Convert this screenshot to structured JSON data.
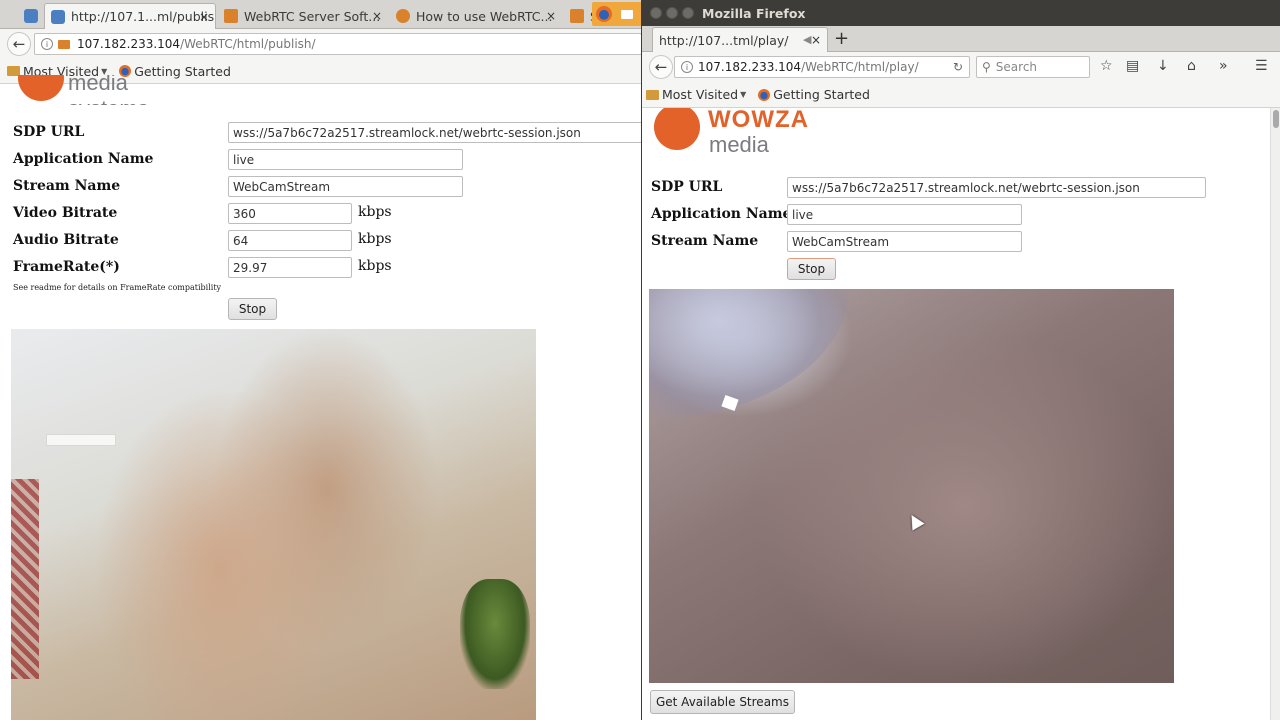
{
  "left_window": {
    "tabs": [
      {
        "label": "http://107.1...ml/publish/",
        "active": true
      },
      {
        "label": "WebRTC Server Soft...",
        "active": false
      },
      {
        "label": "How to use WebRTC...",
        "active": false
      },
      {
        "label": "S",
        "active": false
      }
    ],
    "close_glyph": "×",
    "url_host": "107.182.233.104",
    "url_path": "/WebRTC/html/publish/",
    "bookmarks": {
      "most_visited": "Most Visited",
      "getting_started": "Getting Started"
    },
    "logo_text": "media systems",
    "form": {
      "sdp_url_label": "SDP URL",
      "sdp_url_value": "wss://5a7b6c72a2517.streamlock.net/webrtc-session.json",
      "app_name_label": "Application Name",
      "app_name_value": "live",
      "stream_name_label": "Stream Name",
      "stream_name_value": "WebCamStream",
      "video_bitrate_label": "Video Bitrate",
      "video_bitrate_value": "360",
      "audio_bitrate_label": "Audio Bitrate",
      "audio_bitrate_value": "64",
      "framerate_label": "FrameRate(*)",
      "framerate_value": "29.97",
      "unit": "kbps",
      "note": "See readme for details on FrameRate compatibility",
      "stop_button": "Stop"
    }
  },
  "right_window": {
    "window_title": "Mozilla Firefox",
    "tab_label": "http://107...tml/play/",
    "close_glyph": "×",
    "new_tab_glyph": "+",
    "url_host": "107.182.233.104",
    "url_path": "/WebRTC/html/play/",
    "search_placeholder": "Search",
    "bookmarks": {
      "most_visited": "Most Visited",
      "getting_started": "Getting Started"
    },
    "logo_brand": "WOWZA",
    "logo_text": "media systems",
    "form": {
      "sdp_url_label": "SDP URL",
      "sdp_url_value": "wss://5a7b6c72a2517.streamlock.net/webrtc-session.json",
      "app_name_label": "Application Name",
      "app_name_value": "live",
      "stream_name_label": "Stream Name",
      "stream_name_value": "WebCamStream",
      "stop_button": "Stop"
    },
    "get_streams_button": "Get Available Streams"
  },
  "colors": {
    "brand_orange": "#e2622a",
    "titlebar": "#3d3c38"
  },
  "icons": [
    "back-arrow-icon",
    "info-icon",
    "camera-icon",
    "folder-icon",
    "firefox-icon",
    "reload-icon",
    "search-icon",
    "star-icon",
    "reader-icon",
    "download-icon",
    "home-icon",
    "overflow-icon",
    "menu-icon",
    "speaker-icon"
  ]
}
